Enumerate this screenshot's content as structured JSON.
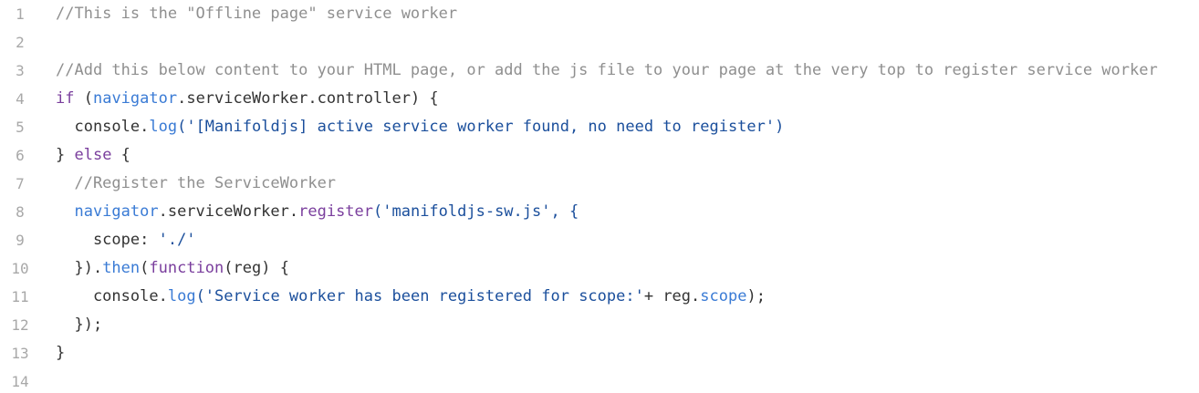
{
  "editor": {
    "line_numbers": [
      "1",
      "2",
      "3",
      "4",
      "5",
      "6",
      "7",
      "8",
      "9",
      "10",
      "11",
      "12",
      "13",
      "14"
    ],
    "lines": [
      {
        "tokens": [
          {
            "t": "//This is the \"Offline page\" service worker",
            "c": "comment"
          }
        ]
      },
      {
        "tokens": []
      },
      {
        "tokens": [
          {
            "t": "//Add this below content to your HTML page, or add the js file to your page at the very top to register service worker",
            "c": "comment"
          }
        ]
      },
      {
        "tokens": [
          {
            "t": "if",
            "c": "keyword"
          },
          {
            "t": " (",
            "c": "plain"
          },
          {
            "t": "navigator",
            "c": "prop"
          },
          {
            "t": ".serviceWorker.controller) {",
            "c": "plain"
          }
        ]
      },
      {
        "tokens": [
          {
            "t": "  console",
            "c": "plain"
          },
          {
            "t": ".",
            "c": "plain"
          },
          {
            "t": "log",
            "c": "prop"
          },
          {
            "t": "('[Manifoldjs] active service worker found, no need to register')",
            "c": "string"
          }
        ]
      },
      {
        "tokens": [
          {
            "t": "} ",
            "c": "plain"
          },
          {
            "t": "else",
            "c": "keyword"
          },
          {
            "t": " {",
            "c": "plain"
          }
        ]
      },
      {
        "tokens": [
          {
            "t": "  //Register the ServiceWorker",
            "c": "comment"
          }
        ]
      },
      {
        "tokens": [
          {
            "t": "  navigator",
            "c": "prop"
          },
          {
            "t": ".serviceWorker.",
            "c": "plain"
          },
          {
            "t": "register",
            "c": "func"
          },
          {
            "t": "('manifoldjs-sw.js', {",
            "c": "string"
          }
        ]
      },
      {
        "tokens": [
          {
            "t": "    scope: ",
            "c": "plain"
          },
          {
            "t": "'./'",
            "c": "string"
          }
        ]
      },
      {
        "tokens": [
          {
            "t": "  }).",
            "c": "plain"
          },
          {
            "t": "then",
            "c": "prop"
          },
          {
            "t": "(",
            "c": "plain"
          },
          {
            "t": "function",
            "c": "keyword"
          },
          {
            "t": "(reg) {",
            "c": "plain"
          }
        ]
      },
      {
        "tokens": [
          {
            "t": "    console",
            "c": "plain"
          },
          {
            "t": ".",
            "c": "plain"
          },
          {
            "t": "log",
            "c": "prop"
          },
          {
            "t": "('Service worker has been registered for scope:'",
            "c": "string"
          },
          {
            "t": "+ reg.",
            "c": "plain"
          },
          {
            "t": "scope",
            "c": "prop"
          },
          {
            "t": ");",
            "c": "plain"
          }
        ]
      },
      {
        "tokens": [
          {
            "t": "  });",
            "c": "plain"
          }
        ]
      },
      {
        "tokens": [
          {
            "t": "}",
            "c": "plain"
          }
        ]
      },
      {
        "tokens": []
      }
    ]
  },
  "colors": {
    "comment": "#8f8f8f",
    "keyword": "#7a3e9d",
    "property": "#3a7bd5",
    "string": "#1b4f9c",
    "plain": "#333333",
    "gutter": "#a8a8a8"
  }
}
